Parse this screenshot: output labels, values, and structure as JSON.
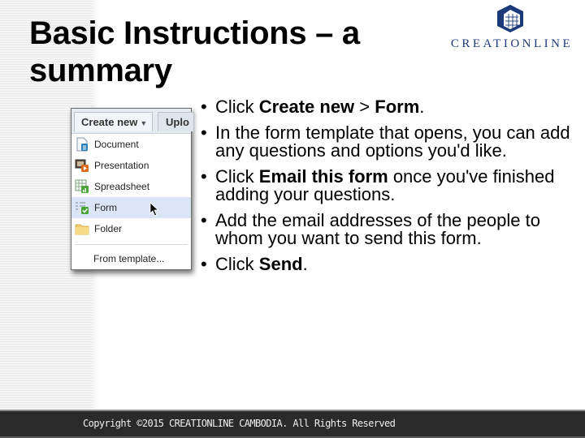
{
  "slide": {
    "title_line1": "Basic Instructions – a",
    "title_line2": "summary"
  },
  "logo": {
    "text": "CREATIONLINE",
    "color": "#1d3a7a"
  },
  "screenshot": {
    "tabs": {
      "create_new": "Create new",
      "upload": "Uplo"
    },
    "menu_items": [
      {
        "label": "Document",
        "icon": "document-icon"
      },
      {
        "label": "Presentation",
        "icon": "presentation-icon"
      },
      {
        "label": "Spreadsheet",
        "icon": "spreadsheet-icon"
      },
      {
        "label": "Form",
        "icon": "form-icon",
        "highlighted": true
      },
      {
        "label": "Folder",
        "icon": "folder-icon"
      }
    ],
    "from_template": "From template..."
  },
  "bullets": [
    {
      "parts": [
        {
          "t": "Click "
        },
        {
          "t": "Create new",
          "b": true
        },
        {
          "t": " > "
        },
        {
          "t": "Form",
          "b": true
        },
        {
          "t": "."
        }
      ]
    },
    {
      "parts": [
        {
          "t": "In the form template that opens, you can add any questions and options you'd like."
        }
      ]
    },
    {
      "parts": [
        {
          "t": "Click "
        },
        {
          "t": "Email this form",
          "b": true
        },
        {
          "t": " once you've finished adding your questions."
        }
      ]
    },
    {
      "parts": [
        {
          "t": "Add the email addresses of the people to whom you want to send this form."
        }
      ]
    },
    {
      "parts": [
        {
          "t": "Click "
        },
        {
          "t": "Send",
          "b": true
        },
        {
          "t": "."
        }
      ]
    }
  ],
  "footer": {
    "copyright": "Copyright ©2015 CREATIONLINE CAMBODIA. All Rights Reserved"
  }
}
